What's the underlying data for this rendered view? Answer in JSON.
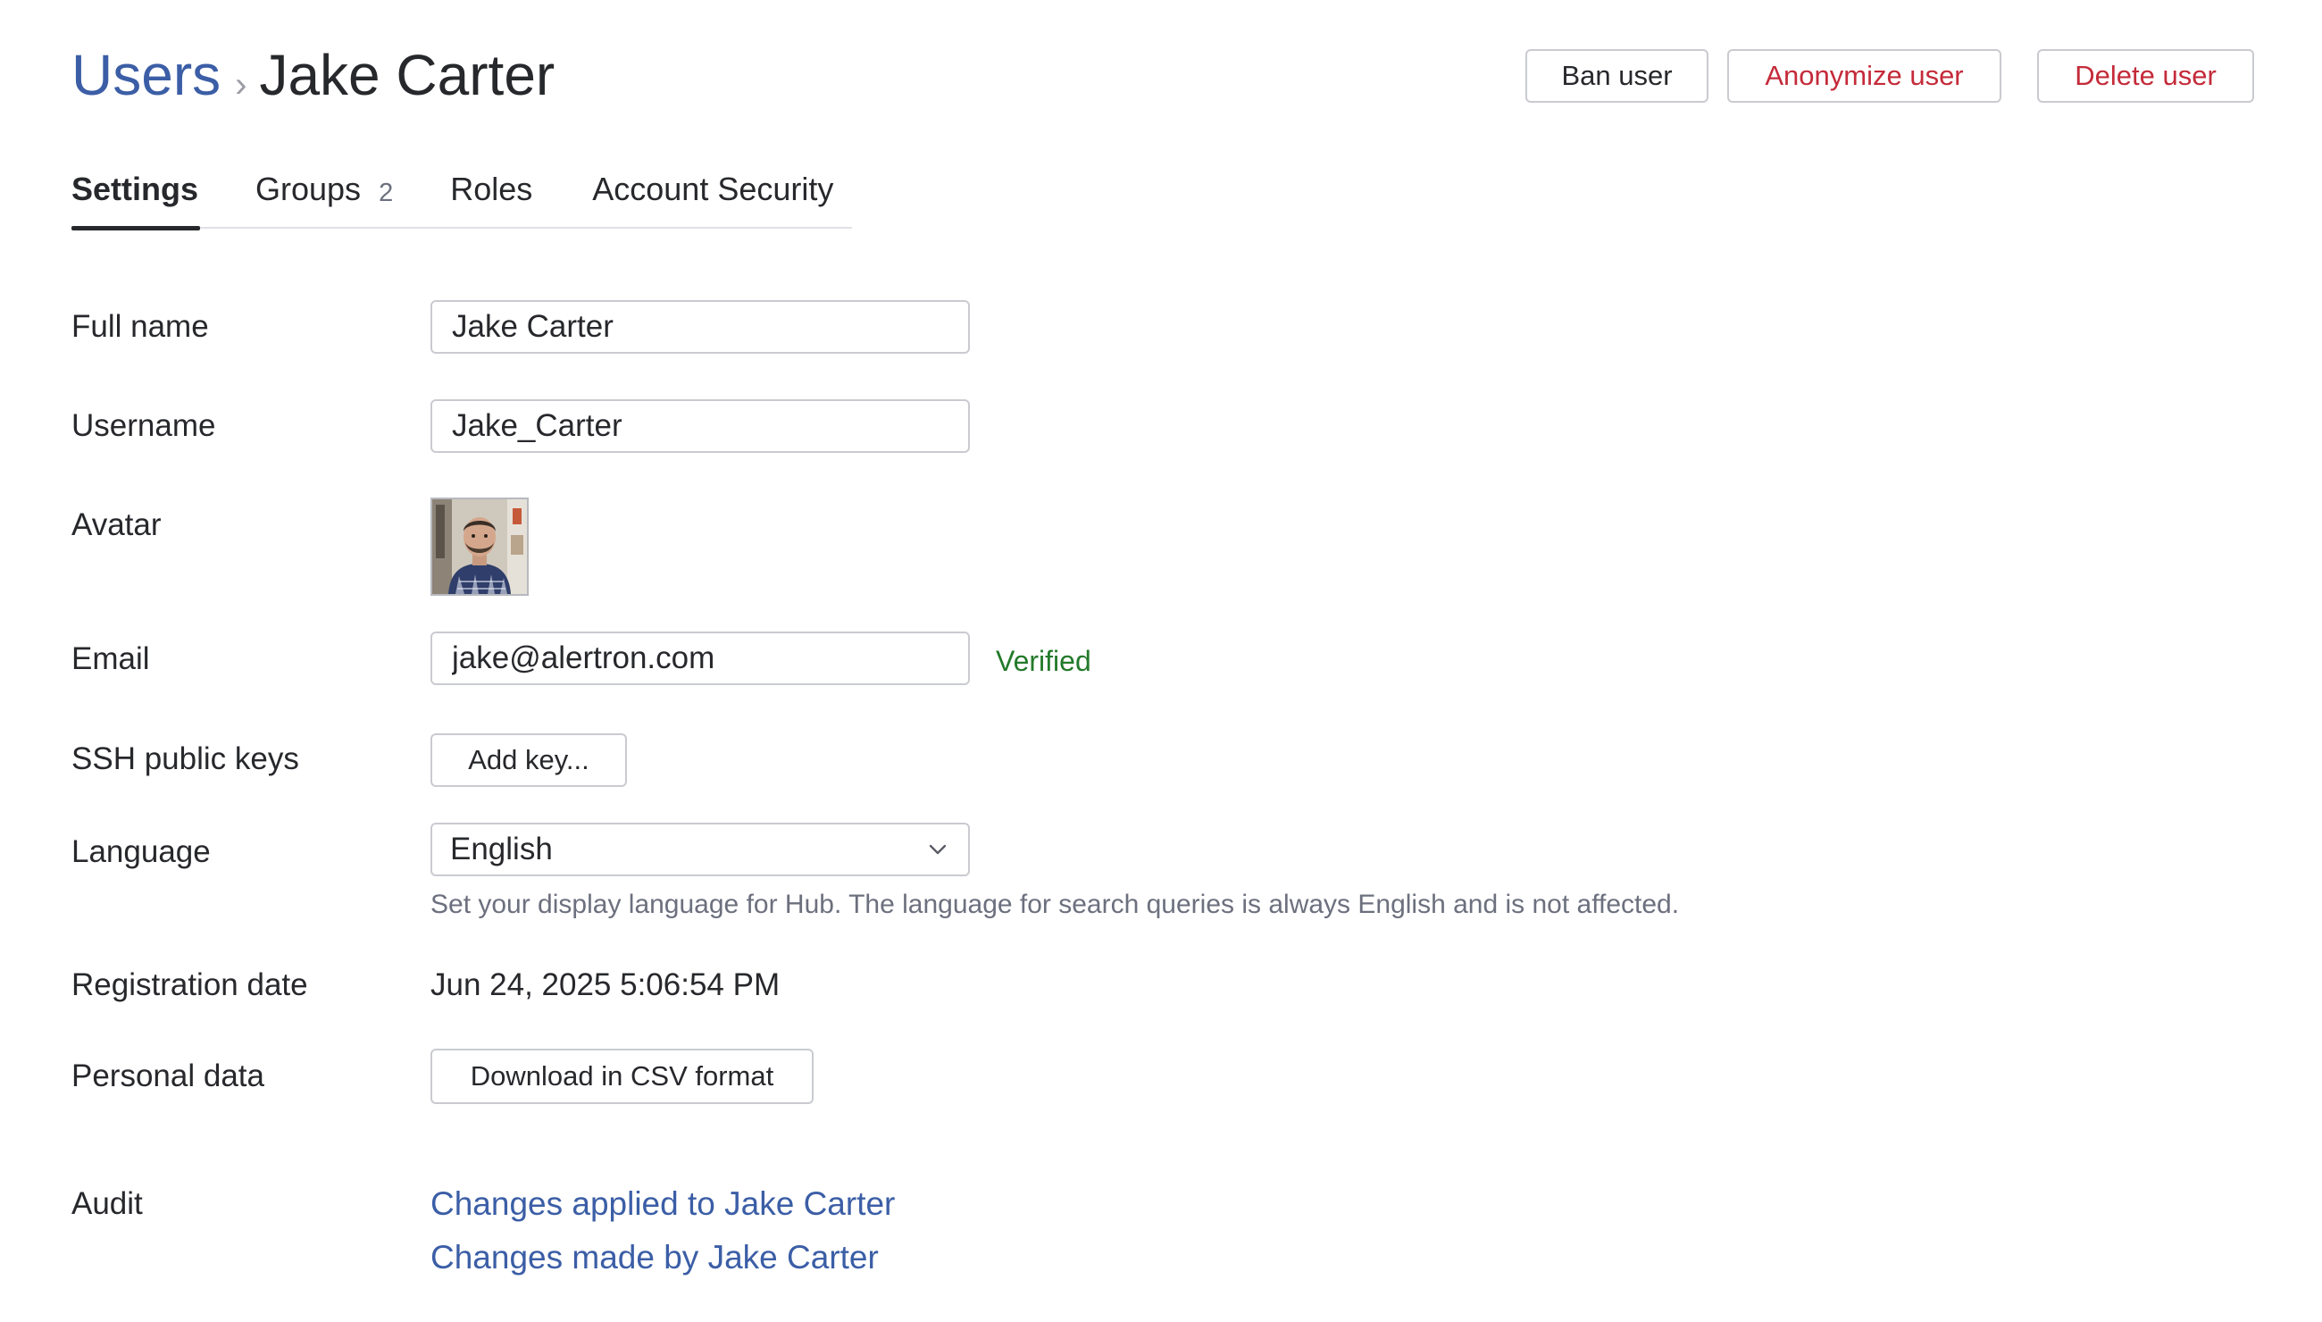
{
  "header": {
    "breadcrumb_root": "Users",
    "breadcrumb_separator": "›",
    "breadcrumb_current": "Jake Carter",
    "actions": {
      "ban": "Ban user",
      "anonymize": "Anonymize user",
      "delete": "Delete user"
    }
  },
  "tabs": [
    {
      "label": "Settings",
      "active": true
    },
    {
      "label": "Groups",
      "count": "2"
    },
    {
      "label": "Roles"
    },
    {
      "label": "Account Security"
    }
  ],
  "form": {
    "full_name": {
      "label": "Full name",
      "value": "Jake Carter"
    },
    "username": {
      "label": "Username",
      "value": "Jake_Carter"
    },
    "avatar": {
      "label": "Avatar"
    },
    "email": {
      "label": "Email",
      "value": "jake@alertron.com",
      "status": "Verified"
    },
    "ssh": {
      "label": "SSH public keys",
      "button": "Add key..."
    },
    "language": {
      "label": "Language",
      "value": "English",
      "hint": "Set your display language for Hub. The language for search queries is always English and is not affected."
    },
    "registration": {
      "label": "Registration date",
      "value": "Jun 24, 2025 5:06:54 PM"
    },
    "personal_data": {
      "label": "Personal data",
      "button": "Download in CSV format"
    },
    "audit": {
      "label": "Audit",
      "links": [
        "Changes applied to Jake Carter",
        "Changes made by Jake Carter"
      ]
    }
  },
  "colors": {
    "link": "#3b5ea6",
    "danger": "#c42b3a",
    "verified": "#237a2a",
    "muted": "#6c707e"
  }
}
